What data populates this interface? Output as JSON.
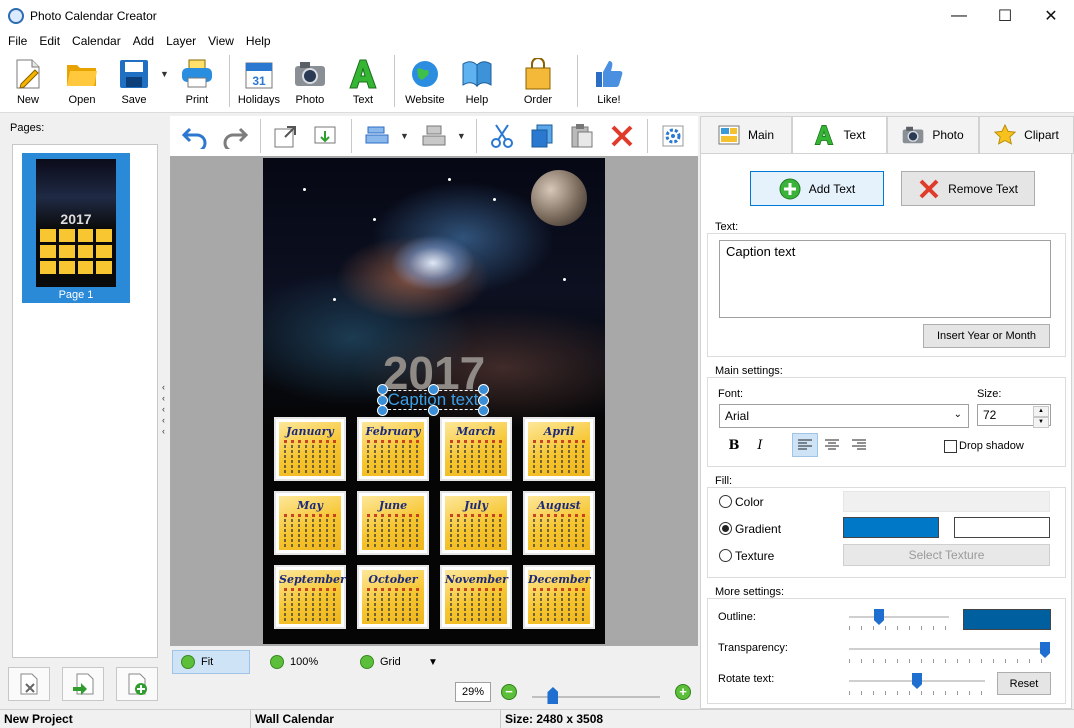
{
  "window": {
    "title": "Photo Calendar Creator"
  },
  "menu": [
    "File",
    "Edit",
    "Calendar",
    "Add",
    "Layer",
    "View",
    "Help"
  ],
  "toolbar": {
    "new": "New",
    "open": "Open",
    "save": "Save",
    "print": "Print",
    "holidays": "Holidays",
    "photo": "Photo",
    "text": "Text",
    "website": "Website",
    "help": "Help",
    "order": "Order",
    "like": "Like!"
  },
  "pages": {
    "label": "Pages:",
    "items": [
      {
        "label": "Page 1",
        "year": "2017"
      }
    ]
  },
  "canvas": {
    "year": "2017",
    "caption": "Caption text",
    "months": [
      "January",
      "February",
      "March",
      "April",
      "May",
      "June",
      "July",
      "August",
      "September",
      "October",
      "November",
      "December"
    ]
  },
  "view": {
    "fit": "Fit",
    "actual": "100%",
    "grid": "Grid",
    "zoom": "29%"
  },
  "panel": {
    "tabs": [
      "Main",
      "Text",
      "Photo",
      "Clipart"
    ],
    "active_tab": "Text",
    "add_text": "Add Text",
    "remove_text": "Remove Text",
    "text_label": "Text:",
    "text_value": "Caption text",
    "insert_year": "Insert Year or Month",
    "main_settings": "Main settings:",
    "font_label": "Font:",
    "font_value": "Arial",
    "size_label": "Size:",
    "size_value": "72",
    "bold": "B",
    "italic": "I",
    "drop_shadow": "Drop shadow",
    "fill_label": "Fill:",
    "fill_color": "Color",
    "fill_gradient": "Gradient",
    "fill_texture": "Texture",
    "select_texture": "Select Texture",
    "more_settings": "More settings:",
    "outline_label": "Outline:",
    "transparency_label": "Transparency:",
    "rotate_label": "Rotate text:",
    "reset": "Reset",
    "gradient_color_1": "#0078c8",
    "gradient_color_2": "#ffffff",
    "outline_color": "#005f9e",
    "outline_level": 0.3,
    "transparency_level": 1.0,
    "rotate_level": 0.5,
    "zoom_level": 0.16
  },
  "status": {
    "project": "New Project",
    "type": "Wall Calendar",
    "size": "Size: 2480 x 3508"
  }
}
